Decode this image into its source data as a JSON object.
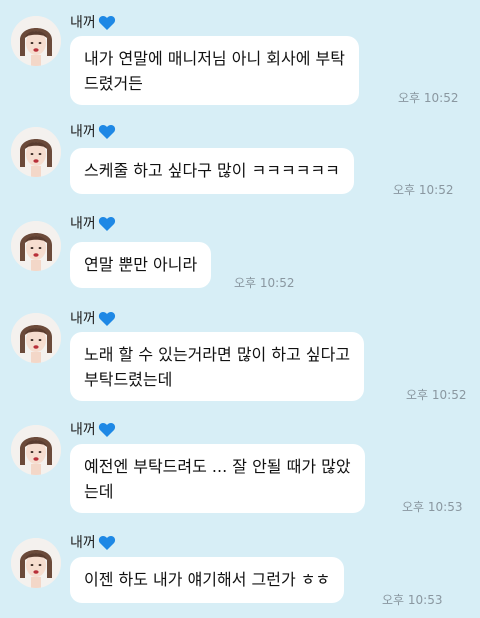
{
  "messages": [
    {
      "sender": "내꺼",
      "lines": [
        "내가 연말에 매니저님 아니 회사에 부탁",
        "드렸거든"
      ],
      "time": "오후 10:52"
    },
    {
      "sender": "내꺼",
      "lines": [
        "스케줄 하고 싶다구 많이 ㅋㅋㅋㅋㅋㅋ"
      ],
      "time": "오후 10:52"
    },
    {
      "sender": "내꺼",
      "lines": [
        "연말 뿐만 아니라"
      ],
      "time": "오후 10:52"
    },
    {
      "sender": "내꺼",
      "lines": [
        "노래 할 수 있는거라면 많이 하고 싶다고",
        "부탁드렸는데"
      ],
      "time": "오후 10:52"
    },
    {
      "sender": "내꺼",
      "lines": [
        "예전엔 부탁드려도 ... 잘 안될 때가 많았",
        "는데"
      ],
      "time": "오후 10:53"
    },
    {
      "sender": "내꺼",
      "lines": [
        "이젠 하도 내가 얘기해서 그런가 ㅎㅎ"
      ],
      "time": "오후 10:53"
    }
  ],
  "colors": {
    "background": "#d7eef6",
    "bubble": "#ffffff",
    "heart": "#1e88e5",
    "time": "#8a97a0"
  },
  "icons": {
    "heart": "blue-heart-emoji"
  }
}
